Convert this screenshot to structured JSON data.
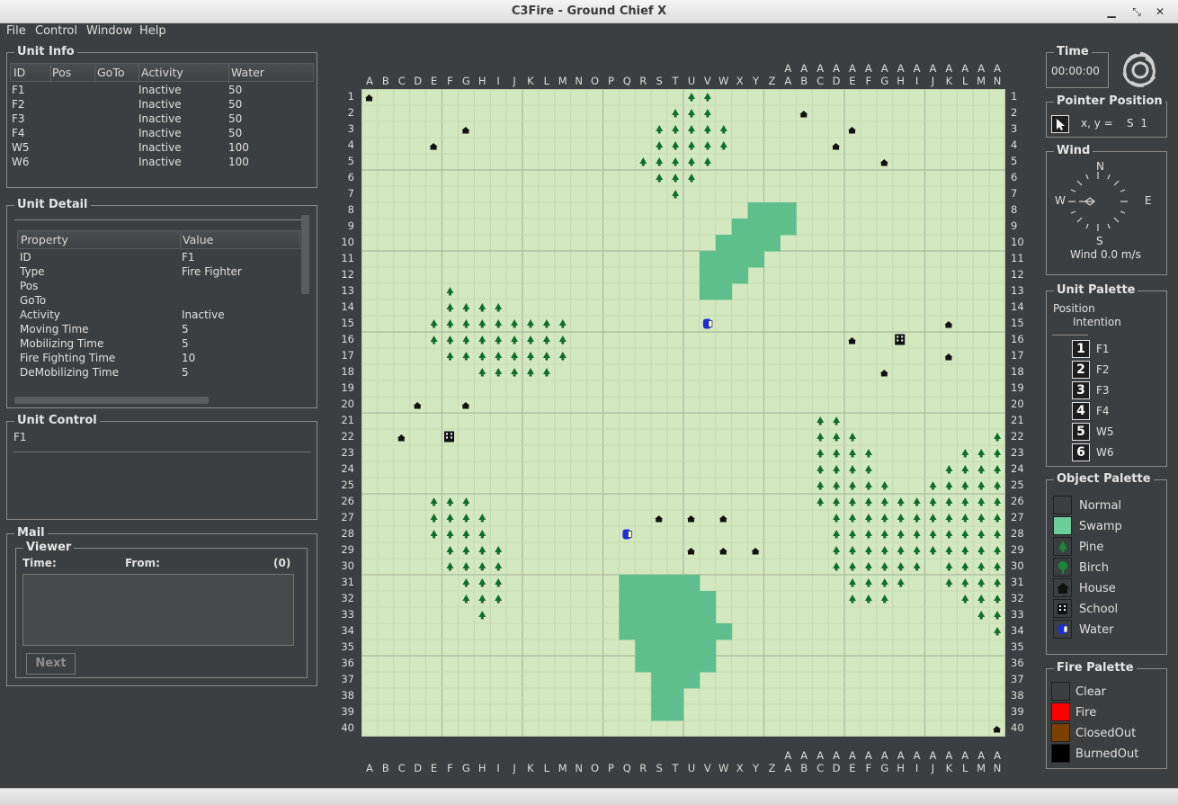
{
  "window": {
    "title": "C3Fire - Ground Chief X"
  },
  "menu": [
    "File",
    "Control",
    "Window",
    "Help"
  ],
  "unit_info": {
    "title": "Unit Info",
    "columns": [
      "ID",
      "Pos",
      "GoTo",
      "Activity",
      "Water"
    ],
    "rows": [
      [
        "F1",
        "",
        "",
        "Inactive",
        "50"
      ],
      [
        "F2",
        "",
        "",
        "Inactive",
        "50"
      ],
      [
        "F3",
        "",
        "",
        "Inactive",
        "50"
      ],
      [
        "F4",
        "",
        "",
        "Inactive",
        "50"
      ],
      [
        "W5",
        "",
        "",
        "Inactive",
        "100"
      ],
      [
        "W6",
        "",
        "",
        "Inactive",
        "100"
      ]
    ]
  },
  "unit_detail": {
    "title": "Unit Detail",
    "columns": [
      "Property",
      "Value"
    ],
    "rows": [
      [
        "ID",
        "F1"
      ],
      [
        "Type",
        "Fire Fighter"
      ],
      [
        "Pos",
        ""
      ],
      [
        "GoTo",
        ""
      ],
      [
        "Activity",
        "Inactive"
      ],
      [
        "Moving Time",
        "5"
      ],
      [
        "Mobilizing Time",
        "5"
      ],
      [
        "Fire Fighting Time",
        "10"
      ],
      [
        "DeMobilizing Time",
        "5"
      ]
    ]
  },
  "unit_control": {
    "title": "Unit Control",
    "selected": "F1"
  },
  "mail": {
    "title": "Mail",
    "viewer": "Viewer",
    "time_label": "Time:",
    "from_label": "From:",
    "count": "(0)",
    "next_label": "Next"
  },
  "time": {
    "title": "Time",
    "value": "00:00:00"
  },
  "pointer": {
    "title": "Pointer Position",
    "label": "x, y =",
    "value": "S 1"
  },
  "wind": {
    "title": "Wind",
    "n": "N",
    "s": "S",
    "e": "E",
    "w": "W",
    "speed": "Wind 0.0 m/s"
  },
  "unit_palette": {
    "title": "Unit Palette",
    "position": "Position",
    "intention": "Intention",
    "units": [
      {
        "num": "1",
        "id": "F1"
      },
      {
        "num": "2",
        "id": "F2"
      },
      {
        "num": "3",
        "id": "F3"
      },
      {
        "num": "4",
        "id": "F4"
      },
      {
        "num": "5",
        "id": "W5"
      },
      {
        "num": "6",
        "id": "W6"
      }
    ]
  },
  "object_palette": {
    "title": "Object Palette",
    "items": [
      {
        "label": "Normal",
        "icon": "normal-icon"
      },
      {
        "label": "Swamp",
        "icon": "swamp-icon"
      },
      {
        "label": "Pine",
        "icon": "pine-icon"
      },
      {
        "label": "Birch",
        "icon": "birch-icon"
      },
      {
        "label": "House",
        "icon": "house-icon"
      },
      {
        "label": "School",
        "icon": "school-icon"
      },
      {
        "label": "Water",
        "icon": "water-icon"
      }
    ]
  },
  "fire_palette": {
    "title": "Fire Palette",
    "items": [
      {
        "label": "Clear",
        "color": "#3c3f41"
      },
      {
        "label": "Fire",
        "color": "#ff0000"
      },
      {
        "label": "ClosedOut",
        "color": "#7b3f00"
      },
      {
        "label": "BurnedOut",
        "color": "#000000"
      }
    ]
  },
  "map": {
    "columns": [
      "A",
      "B",
      "C",
      "D",
      "E",
      "F",
      "G",
      "H",
      "I",
      "J",
      "K",
      "L",
      "M",
      "N",
      "O",
      "P",
      "Q",
      "R",
      "S",
      "T",
      "U",
      "V",
      "W",
      "X",
      "Y",
      "Z",
      "AA",
      "AB",
      "AC",
      "AD",
      "AE",
      "AF",
      "AG",
      "AH",
      "AI",
      "AJ",
      "AK",
      "AL",
      "AM",
      "AN"
    ],
    "rows": 40,
    "colors": {
      "grass": "#d4e8c0",
      "swamp": "#5fbf8c",
      "pine": "#0f6e2a",
      "house": "#111111",
      "water": "#1a2ee0"
    },
    "pines": [
      [
        20,
        1
      ],
      [
        21,
        1
      ],
      [
        19,
        2
      ],
      [
        20,
        2
      ],
      [
        21,
        2
      ],
      [
        18,
        3
      ],
      [
        19,
        3
      ],
      [
        20,
        3
      ],
      [
        21,
        3
      ],
      [
        22,
        3
      ],
      [
        18,
        4
      ],
      [
        19,
        4
      ],
      [
        20,
        4
      ],
      [
        21,
        4
      ],
      [
        22,
        4
      ],
      [
        17,
        5
      ],
      [
        18,
        5
      ],
      [
        19,
        5
      ],
      [
        20,
        5
      ],
      [
        21,
        5
      ],
      [
        18,
        6
      ],
      [
        19,
        6
      ],
      [
        20,
        6
      ],
      [
        19,
        7
      ],
      [
        5,
        13
      ],
      [
        5,
        14
      ],
      [
        6,
        14
      ],
      [
        7,
        14
      ],
      [
        8,
        14
      ],
      [
        4,
        15
      ],
      [
        5,
        15
      ],
      [
        6,
        15
      ],
      [
        7,
        15
      ],
      [
        8,
        15
      ],
      [
        9,
        15
      ],
      [
        10,
        15
      ],
      [
        11,
        15
      ],
      [
        12,
        15
      ],
      [
        4,
        16
      ],
      [
        5,
        16
      ],
      [
        6,
        16
      ],
      [
        7,
        16
      ],
      [
        8,
        16
      ],
      [
        9,
        16
      ],
      [
        10,
        16
      ],
      [
        11,
        16
      ],
      [
        12,
        16
      ],
      [
        5,
        17
      ],
      [
        6,
        17
      ],
      [
        7,
        17
      ],
      [
        8,
        17
      ],
      [
        9,
        17
      ],
      [
        10,
        17
      ],
      [
        11,
        17
      ],
      [
        12,
        17
      ],
      [
        7,
        18
      ],
      [
        8,
        18
      ],
      [
        9,
        18
      ],
      [
        10,
        18
      ],
      [
        11,
        18
      ],
      [
        4,
        26
      ],
      [
        5,
        26
      ],
      [
        6,
        26
      ],
      [
        4,
        27
      ],
      [
        5,
        27
      ],
      [
        6,
        27
      ],
      [
        7,
        27
      ],
      [
        4,
        28
      ],
      [
        5,
        28
      ],
      [
        6,
        28
      ],
      [
        7,
        28
      ],
      [
        5,
        29
      ],
      [
        6,
        29
      ],
      [
        7,
        29
      ],
      [
        8,
        29
      ],
      [
        5,
        30
      ],
      [
        6,
        30
      ],
      [
        7,
        30
      ],
      [
        8,
        30
      ],
      [
        6,
        31
      ],
      [
        7,
        31
      ],
      [
        8,
        31
      ],
      [
        6,
        32
      ],
      [
        7,
        32
      ],
      [
        8,
        32
      ],
      [
        7,
        33
      ],
      [
        28,
        21
      ],
      [
        29,
        21
      ],
      [
        28,
        22
      ],
      [
        29,
        22
      ],
      [
        30,
        22
      ],
      [
        28,
        23
      ],
      [
        29,
        23
      ],
      [
        30,
        23
      ],
      [
        31,
        23
      ],
      [
        28,
        24
      ],
      [
        29,
        24
      ],
      [
        30,
        24
      ],
      [
        31,
        24
      ],
      [
        28,
        25
      ],
      [
        29,
        25
      ],
      [
        30,
        25
      ],
      [
        31,
        25
      ],
      [
        32,
        25
      ],
      [
        28,
        26
      ],
      [
        29,
        26
      ],
      [
        30,
        26
      ],
      [
        31,
        26
      ],
      [
        32,
        26
      ],
      [
        33,
        26
      ],
      [
        34,
        26
      ],
      [
        29,
        27
      ],
      [
        30,
        27
      ],
      [
        31,
        27
      ],
      [
        32,
        27
      ],
      [
        33,
        27
      ],
      [
        34,
        27
      ],
      [
        29,
        28
      ],
      [
        30,
        28
      ],
      [
        31,
        28
      ],
      [
        32,
        28
      ],
      [
        33,
        28
      ],
      [
        34,
        28
      ],
      [
        29,
        29
      ],
      [
        30,
        29
      ],
      [
        31,
        29
      ],
      [
        32,
        29
      ],
      [
        33,
        29
      ],
      [
        34,
        29
      ],
      [
        29,
        30
      ],
      [
        30,
        30
      ],
      [
        31,
        30
      ],
      [
        32,
        30
      ],
      [
        33,
        30
      ],
      [
        34,
        30
      ],
      [
        30,
        31
      ],
      [
        31,
        31
      ],
      [
        32,
        31
      ],
      [
        33,
        31
      ],
      [
        30,
        32
      ],
      [
        31,
        32
      ],
      [
        32,
        32
      ],
      [
        39,
        22
      ],
      [
        37,
        23
      ],
      [
        38,
        23
      ],
      [
        39,
        23
      ],
      [
        36,
        24
      ],
      [
        37,
        24
      ],
      [
        38,
        24
      ],
      [
        39,
        24
      ],
      [
        35,
        25
      ],
      [
        36,
        25
      ],
      [
        37,
        25
      ],
      [
        38,
        25
      ],
      [
        39,
        25
      ],
      [
        35,
        26
      ],
      [
        36,
        26
      ],
      [
        37,
        26
      ],
      [
        38,
        26
      ],
      [
        39,
        26
      ],
      [
        35,
        27
      ],
      [
        36,
        27
      ],
      [
        37,
        27
      ],
      [
        38,
        27
      ],
      [
        39,
        27
      ],
      [
        35,
        28
      ],
      [
        36,
        28
      ],
      [
        37,
        28
      ],
      [
        38,
        28
      ],
      [
        39,
        28
      ],
      [
        35,
        29
      ],
      [
        36,
        29
      ],
      [
        37,
        29
      ],
      [
        38,
        29
      ],
      [
        39,
        29
      ],
      [
        36,
        30
      ],
      [
        37,
        30
      ],
      [
        38,
        30
      ],
      [
        39,
        30
      ],
      [
        36,
        31
      ],
      [
        37,
        31
      ],
      [
        38,
        31
      ],
      [
        39,
        31
      ],
      [
        37,
        32
      ],
      [
        38,
        32
      ],
      [
        39,
        32
      ],
      [
        38,
        33
      ],
      [
        39,
        33
      ],
      [
        39,
        34
      ]
    ],
    "swamp": [
      [
        24,
        8
      ],
      [
        25,
        8
      ],
      [
        26,
        8
      ],
      [
        24,
        9
      ],
      [
        25,
        9
      ],
      [
        26,
        9
      ],
      [
        23,
        10
      ],
      [
        24,
        10
      ],
      [
        25,
        10
      ],
      [
        22,
        11
      ],
      [
        23,
        11
      ],
      [
        24,
        11
      ],
      [
        21,
        12
      ],
      [
        22,
        12
      ],
      [
        23,
        12
      ],
      [
        21,
        13
      ],
      [
        22,
        13
      ],
      [
        21,
        11
      ],
      [
        21,
        12
      ],
      [
        22,
        10
      ],
      [
        23,
        9
      ],
      [
        24,
        10
      ],
      [
        18,
        31
      ],
      [
        19,
        31
      ],
      [
        17,
        32
      ],
      [
        18,
        32
      ],
      [
        19,
        32
      ],
      [
        20,
        32
      ],
      [
        16,
        33
      ],
      [
        17,
        33
      ],
      [
        18,
        33
      ],
      [
        19,
        33
      ],
      [
        20,
        33
      ],
      [
        21,
        33
      ],
      [
        16,
        34
      ],
      [
        17,
        34
      ],
      [
        18,
        34
      ],
      [
        19,
        34
      ],
      [
        20,
        34
      ],
      [
        21,
        34
      ],
      [
        22,
        34
      ],
      [
        17,
        35
      ],
      [
        18,
        35
      ],
      [
        19,
        35
      ],
      [
        20,
        35
      ],
      [
        21,
        35
      ],
      [
        17,
        36
      ],
      [
        18,
        36
      ],
      [
        19,
        36
      ],
      [
        20,
        36
      ],
      [
        21,
        36
      ],
      [
        18,
        37
      ],
      [
        19,
        37
      ],
      [
        20,
        37
      ],
      [
        18,
        38
      ],
      [
        19,
        38
      ],
      [
        18,
        39
      ],
      [
        19,
        39
      ],
      [
        17,
        31
      ],
      [
        16,
        31
      ],
      [
        20,
        31
      ],
      [
        16,
        32
      ],
      [
        21,
        32
      ]
    ],
    "houses": [
      [
        0,
        1
      ],
      [
        6,
        3
      ],
      [
        4,
        4
      ],
      [
        27,
        2
      ],
      [
        30,
        3
      ],
      [
        29,
        4
      ],
      [
        32,
        5
      ],
      [
        30,
        16
      ],
      [
        36,
        15
      ],
      [
        36,
        17
      ],
      [
        32,
        18
      ],
      [
        3,
        20
      ],
      [
        6,
        20
      ],
      [
        2,
        22
      ],
      [
        18,
        27
      ],
      [
        20,
        27
      ],
      [
        22,
        27
      ],
      [
        20,
        29
      ],
      [
        22,
        29
      ],
      [
        24,
        29
      ],
      [
        39,
        40
      ]
    ],
    "schools": [
      [
        33,
        16
      ],
      [
        5,
        22
      ]
    ],
    "water": [
      [
        21,
        15
      ],
      [
        16,
        28
      ]
    ]
  }
}
